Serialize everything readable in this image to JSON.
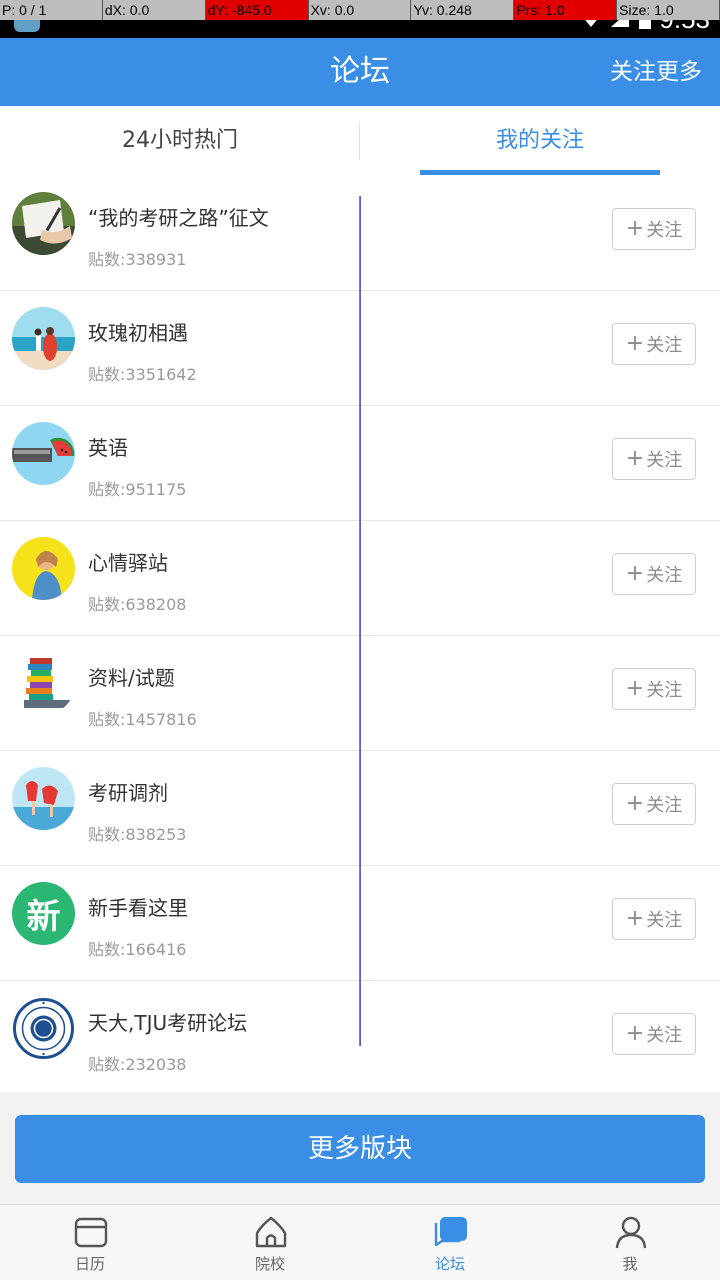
{
  "debug_overlay": [
    "P: 0 / 1",
    "dX: 0.0",
    "dY: -845.0",
    "Xv: 0.0",
    "Yv: 0.248",
    "Prs: 1.0",
    "Size: 1.0"
  ],
  "status_bar": {
    "time": "9:53"
  },
  "header": {
    "title": "论坛",
    "action_label": "关注更多"
  },
  "tabs": [
    {
      "label": "24小时热门",
      "active": false
    },
    {
      "label": "我的关注",
      "active": true
    }
  ],
  "forums": [
    {
      "title": "“我的考研之路”征文",
      "count": "贴数:338931",
      "follow_label": "关注",
      "avatar": "writing-photo"
    },
    {
      "title": "玫瑰初相遇",
      "count": "贴数:3351642",
      "follow_label": "关注",
      "avatar": "beach-couple-photo"
    },
    {
      "title": "英语",
      "count": "贴数:951175",
      "follow_label": "关注",
      "avatar": "watermelon-photo"
    },
    {
      "title": "心情驿站",
      "count": "贴数:638208",
      "follow_label": "关注",
      "avatar": "girl-yellow-photo"
    },
    {
      "title": "资料/试题",
      "count": "贴数:1457816",
      "follow_label": "关注",
      "avatar": "book-stack-photo"
    },
    {
      "title": "考研调剂",
      "count": "贴数:838253",
      "follow_label": "关注",
      "avatar": "balloons-photo"
    },
    {
      "title": "新手看这里",
      "count": "贴数:166416",
      "follow_label": "关注",
      "avatar": "new-badge",
      "badge_text": "新"
    },
    {
      "title": "天大,TJU考研论坛",
      "count": "贴数:232038",
      "follow_label": "关注",
      "avatar": "tju-seal"
    }
  ],
  "more_button": {
    "label": "更多版块"
  },
  "bottom_nav": [
    {
      "label": "日历",
      "icon": "calendar-icon",
      "active": false
    },
    {
      "label": "院校",
      "icon": "school-icon",
      "active": false
    },
    {
      "label": "论坛",
      "icon": "chat-icon",
      "active": true
    },
    {
      "label": "我",
      "icon": "user-icon",
      "active": false
    }
  ],
  "colors": {
    "primary": "#3a8ee6",
    "background": "#f2f2f2",
    "new_badge": "#2bb673"
  }
}
